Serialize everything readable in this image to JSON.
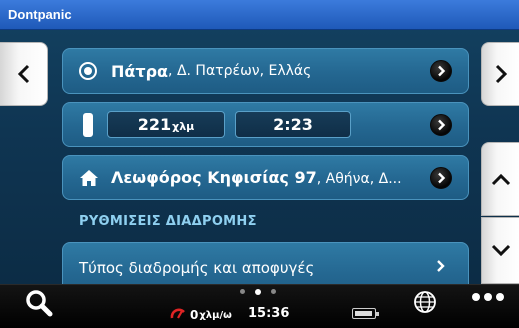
{
  "app": {
    "title": "Dontpanic"
  },
  "origin": {
    "city": "Πάτρα",
    "detail": ", Δ. Πατρέων, Ελλάς"
  },
  "summary": {
    "distance_value": "221",
    "distance_unit": "χλμ",
    "duration": "2:23"
  },
  "destination": {
    "street": "Λεωφόρος Κηφισίας 97",
    "detail": ", Αθήνα, Δ..."
  },
  "section": {
    "title": "ΡΥΘΜΙΣΕΙΣ ΔΙΑΔΡΟΜΗΣ"
  },
  "route_options": {
    "label": "Τύπος διαδρομής και αποφυγές"
  },
  "statusbar": {
    "speed_value": "0",
    "speed_unit": "χλμ/ω",
    "time": "15:36",
    "page_count": 3,
    "active_page": 2
  },
  "icons": {
    "back": "chevron-left-icon",
    "forward": "chevron-right-icon",
    "scroll_up": "chevron-up-icon",
    "scroll_down": "chevron-down-icon",
    "origin": "location-target-icon",
    "destination": "home-icon",
    "search": "search-icon",
    "globe": "globe-icon",
    "more": "more-dots-icon",
    "battery": "battery-icon",
    "speed": "speed-gauge-icon"
  },
  "colors": {
    "titlebar": "#2a67c9",
    "card": "#2a709b",
    "section_title": "#8fd0f0",
    "speed_icon": "#e02424"
  }
}
